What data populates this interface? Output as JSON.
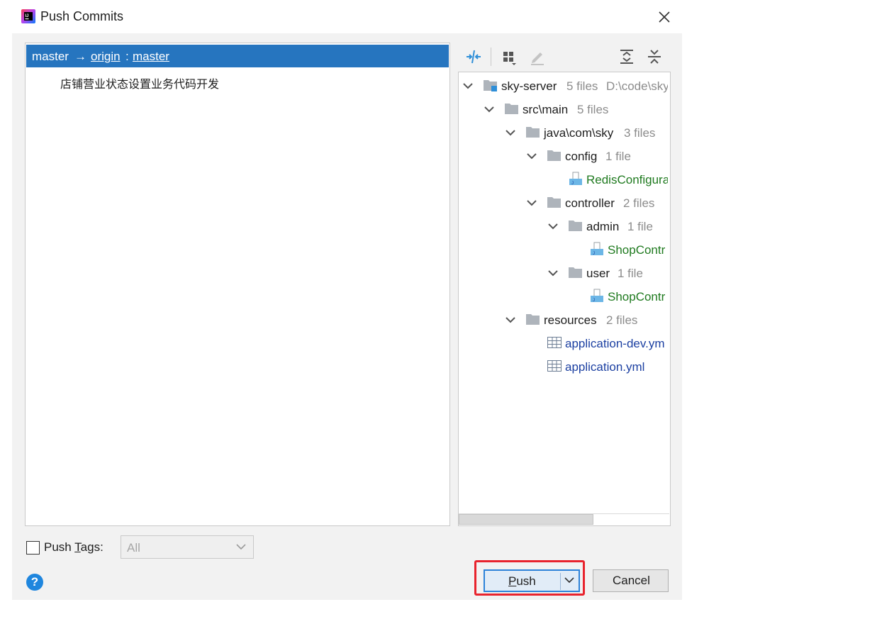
{
  "window": {
    "title": "Push Commits",
    "icon": "intellij-idea-icon"
  },
  "left_pane": {
    "branch": {
      "local": "master",
      "arrow": "→",
      "remote": "origin",
      "separator": ":",
      "remote_branch": "master"
    },
    "commits": [
      "店铺营业状态设置业务代码开发"
    ]
  },
  "toolbar": {
    "icons": [
      "compare-icon",
      "group-by-icon",
      "edit-icon",
      "expand-all-icon",
      "collapse-all-icon"
    ]
  },
  "tree": [
    {
      "name": "sky-server",
      "count": "5 files",
      "extra": "D:\\code\\sky"
    },
    {
      "name": "src\\main",
      "count": "5 files"
    },
    {
      "name": "java\\com\\sky",
      "count": "3 files"
    },
    {
      "name": "config",
      "count": "1 file"
    },
    {
      "name": "RedisConfigura"
    },
    {
      "name": "controller",
      "count": "2 files"
    },
    {
      "name": "admin",
      "count": "1 file"
    },
    {
      "name": "ShopContr"
    },
    {
      "name": "user",
      "count": "1 file"
    },
    {
      "name": "ShopContr"
    },
    {
      "name": "resources",
      "count": "2 files"
    },
    {
      "name": "application-dev.ym"
    },
    {
      "name": "application.yml"
    }
  ],
  "push_tags": {
    "label_prefix": "Push ",
    "label_mnemonic": "T",
    "label_suffix": "ags:",
    "checked": false,
    "selected": "All"
  },
  "buttons": {
    "push_mnemonic": "P",
    "push_rest": "ush",
    "cancel": "Cancel",
    "help": "?"
  },
  "colors": {
    "selection": "#2675bf",
    "highlight_border": "#e8232d",
    "added_file": "#1f7a1f",
    "modified_file": "#1b3fa1"
  }
}
